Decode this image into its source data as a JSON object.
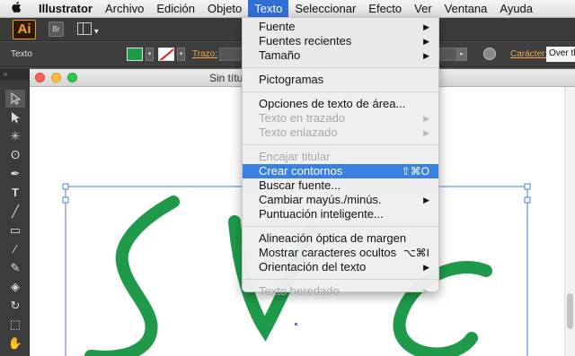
{
  "menubar": {
    "app": "Illustrator",
    "items": [
      "Archivo",
      "Edición",
      "Objeto",
      "Texto",
      "Seleccionar",
      "Efecto",
      "Ver",
      "Ventana",
      "Ayuda"
    ]
  },
  "apptoolbar": {
    "logo": "Ai",
    "bridge": "Br"
  },
  "control": {
    "label": "Texto",
    "stroke_label": "Trazo:",
    "char_label": "Carácter:",
    "font_value": "Over the"
  },
  "tools": {
    "grip": "»"
  },
  "document": {
    "title": "Sin títul"
  },
  "menu": {
    "fuente": "Fuente",
    "fuentes_recientes": "Fuentes recientes",
    "tamano": "Tamaño",
    "pictogramas": "Pictogramas",
    "opciones_area": "Opciones de texto de área...",
    "texto_trazado": "Texto en trazado",
    "texto_enlazado": "Texto enlazado",
    "encajar_titular": "Encajar titular",
    "crear_contornos": "Crear contornos",
    "crear_contornos_shortcut": "⇧⌘O",
    "buscar_fuente": "Buscar fuente...",
    "cambiar_mayus": "Cambiar mayús./minús.",
    "puntuacion": "Puntuación inteligente...",
    "alineacion": "Alineación óptica de margen",
    "mostrar_caracteres": "Mostrar caracteres ocultos",
    "mostrar_caracteres_shortcut": "⌥⌘I",
    "orientacion": "Orientación del texto",
    "texto_heredado": "Texto heredado"
  },
  "colors": {
    "fill": "#1f9a4a",
    "menu_highlight": "#3a7fe2",
    "menubar_active": "#2f6fd6"
  }
}
